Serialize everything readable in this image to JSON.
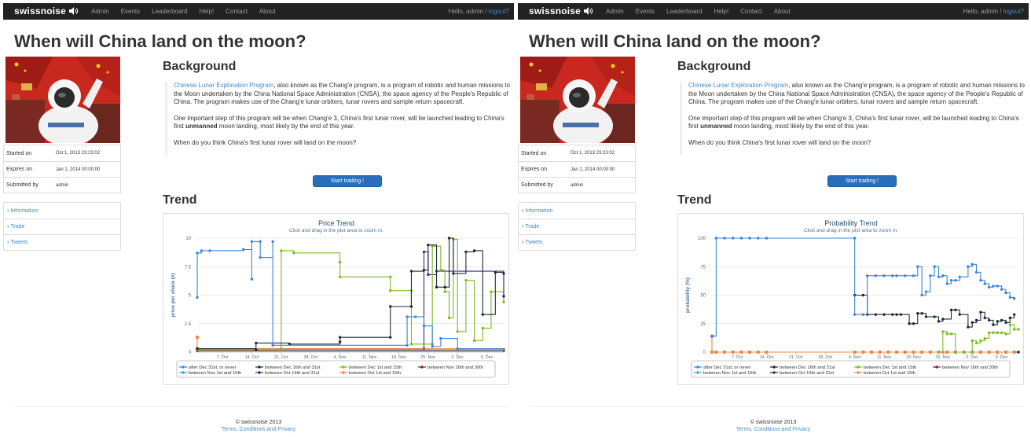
{
  "nav": {
    "brand": "swissnoise",
    "links": [
      "Admin",
      "Events",
      "Leaderboard",
      "Help!",
      "Contact",
      "About"
    ],
    "greeting": "Hello, admin !",
    "logout": "logout?"
  },
  "page": {
    "title": "When will China land on the moon?",
    "info": [
      {
        "label": "Started on",
        "value": "Oct 1, 2013 23:23:02"
      },
      {
        "label": "Expires on",
        "value": "Jan 1, 2014 00:00:00"
      },
      {
        "label": "Submitted by",
        "value": "admin"
      }
    ],
    "sidenav": [
      "Information",
      "Trade",
      "Tweets"
    ],
    "background_heading": "Background",
    "background": {
      "link_text": "Chinese Lunar Exploration Program",
      "p1_rest": ", also known as the Chang'e program, is a program of robotic and human missions to the Moon undertaken by the China National Space Administration (CNSA), the space agency of the People's Republic of China. The program makes use of the Chang'e lunar orbiters, lunar rovers and sample return spacecraft.",
      "p2_before": "One important step of this program will be when Chang'e 3, China's first lunar rover, will be launched leading to China's first ",
      "p2_bold": "unmanned",
      "p2_after": " moon landing, most likely by the end of this year.",
      "p3": "When do you think China's first lunar rover will land on the moon?"
    },
    "cta": "Start trading !",
    "trend_heading": "Trend",
    "footer": {
      "copyright": "© swissnoise 2013",
      "link": "Terms, Conditions and Privacy"
    }
  },
  "colors": {
    "s1": "#3b85d8",
    "s2": "#1c2b3a",
    "s3": "#7cb928",
    "s4": "#8b1e1e",
    "s5": "#2bb5c0",
    "s6": "#3a2a6e",
    "s7": "#e88a4a",
    "navbar": "#222222",
    "link": "#428bca",
    "button": "#2a6ebb"
  },
  "chart_data": [
    {
      "type": "line",
      "title": "Price Trend",
      "subtitle": "Click and drag in the plot area to zoom in.",
      "ylabel": "price per share (¤)",
      "xlabel": "",
      "yticks": [
        0,
        2.5,
        5,
        7.5,
        10
      ],
      "ylim": [
        0,
        10
      ],
      "xticks": [
        "7. Oct",
        "14. Oct",
        "21. Oct",
        "28. Oct",
        "4. Nov",
        "11. Nov",
        "18. Nov",
        "25. Nov",
        "2. Dec",
        "9. Dec"
      ],
      "x_dates": [
        "2013-10-07",
        "2013-10-14",
        "2013-10-21",
        "2013-10-28",
        "2013-11-04",
        "2013-11-11",
        "2013-11-18",
        "2013-11-25",
        "2013-12-02",
        "2013-12-09"
      ],
      "xlim": [
        "2013-10-01",
        "2013-12-13"
      ],
      "grid": true,
      "legend_position": "bottom",
      "series": [
        {
          "name": "after Dec 31st, or never",
          "points": [
            [
              "2013-10-01",
              4.8
            ],
            [
              "2013-10-01",
              8.7
            ],
            [
              "2013-10-02",
              8.9
            ],
            [
              "2013-10-04",
              8.9
            ],
            [
              "2013-10-12",
              9.0
            ],
            [
              "2013-10-14",
              6.4
            ],
            [
              "2013-10-14",
              9.7
            ],
            [
              "2013-10-16",
              9.7
            ],
            [
              "2013-10-16",
              8.3
            ],
            [
              "2013-10-19",
              9.7
            ],
            [
              "2013-10-19",
              0.6
            ],
            [
              "2013-11-20",
              0.6
            ],
            [
              "2013-11-20",
              3.1
            ],
            [
              "2013-11-22",
              3.1
            ],
            [
              "2013-11-24",
              2.3
            ],
            [
              "2013-11-26",
              0.5
            ],
            [
              "2013-11-28",
              1.2
            ],
            [
              "2013-12-02",
              0.3
            ],
            [
              "2013-12-13",
              0.2
            ]
          ]
        },
        {
          "name": "between Dec 16th and 31st",
          "points": [
            [
              "2013-10-01",
              0.3
            ],
            [
              "2013-10-15",
              0.2
            ],
            [
              "2013-10-15",
              0.8
            ],
            [
              "2013-10-23",
              0.7
            ],
            [
              "2013-11-04",
              0.9
            ],
            [
              "2013-11-04",
              1.3
            ],
            [
              "2013-11-16",
              1.3
            ],
            [
              "2013-11-16",
              4.0
            ],
            [
              "2013-11-21",
              4.0
            ],
            [
              "2013-11-21",
              7.1
            ],
            [
              "2013-11-24",
              7.2
            ],
            [
              "2013-11-25",
              9.4
            ],
            [
              "2013-11-27",
              5.7
            ],
            [
              "2013-11-29",
              5.7
            ],
            [
              "2013-11-30",
              10.0
            ],
            [
              "2013-12-01",
              6.9
            ],
            [
              "2013-12-04",
              8.8
            ],
            [
              "2013-12-06",
              8.9
            ],
            [
              "2013-12-08",
              3.3
            ],
            [
              "2013-12-11",
              7.0
            ],
            [
              "2013-12-13",
              4.9
            ]
          ]
        },
        {
          "name": "between Dec 1st and 15th",
          "points": [
            [
              "2013-10-01",
              0.2
            ],
            [
              "2013-10-21",
              0.3
            ],
            [
              "2013-10-21",
              8.9
            ],
            [
              "2013-10-24",
              8.7
            ],
            [
              "2013-11-04",
              7.9
            ],
            [
              "2013-11-04",
              6.6
            ],
            [
              "2013-11-16",
              6.6
            ],
            [
              "2013-11-16",
              5.4
            ],
            [
              "2013-11-21",
              5.4
            ],
            [
              "2013-11-21",
              0.7
            ],
            [
              "2013-11-26",
              0.7
            ],
            [
              "2013-11-26",
              9.3
            ],
            [
              "2013-11-28",
              7.2
            ],
            [
              "2013-11-29",
              5.3
            ],
            [
              "2013-11-30",
              3.0
            ],
            [
              "2013-12-01",
              9.9
            ],
            [
              "2013-12-02",
              1.8
            ],
            [
              "2013-12-04",
              6.3
            ],
            [
              "2013-12-06",
              1.0
            ],
            [
              "2013-12-08",
              2.1
            ],
            [
              "2013-12-10",
              5.3
            ],
            [
              "2013-12-13",
              4.4
            ]
          ]
        },
        {
          "name": "between Nov 16th and 30th",
          "points": [
            [
              "2013-10-01",
              0.1
            ],
            [
              "2013-12-13",
              0.1
            ]
          ]
        },
        {
          "name": "between Nov 1st and 15th",
          "points": [
            [
              "2013-10-01",
              0.2
            ],
            [
              "2013-12-13",
              0.2
            ]
          ]
        },
        {
          "name": "between Oct 16th and 31st",
          "points": [
            [
              "2013-10-01",
              0.3
            ],
            [
              "2013-11-24",
              0.3
            ],
            [
              "2013-11-24",
              8.8
            ],
            [
              "2013-11-25",
              6.8
            ],
            [
              "2013-11-27",
              7.1
            ],
            [
              "2013-12-13",
              6.9
            ]
          ]
        },
        {
          "name": "between Oct 1st and 15th",
          "points": [
            [
              "2013-10-01",
              1.3
            ],
            [
              "2013-10-01",
              0.3
            ],
            [
              "2013-12-13",
              0.2
            ]
          ]
        }
      ]
    },
    {
      "type": "line",
      "title": "Probability Trend",
      "subtitle": "Click and drag in the plot area to zoom in.",
      "ylabel": "probability (%)",
      "xlabel": "",
      "yticks": [
        0,
        25,
        50,
        75,
        100
      ],
      "ylim": [
        0,
        100
      ],
      "xticks": [
        "7. Oct",
        "14. Oct",
        "21. Oct",
        "28. Oct",
        "4. Nov",
        "11. Nov",
        "18. Nov",
        "25. Nov",
        "2. Dec",
        "9. Dec"
      ],
      "x_dates": [
        "2013-10-07",
        "2013-10-14",
        "2013-10-21",
        "2013-10-28",
        "2013-11-04",
        "2013-11-11",
        "2013-11-18",
        "2013-11-25",
        "2013-12-02",
        "2013-12-09"
      ],
      "xlim": [
        "2013-10-01",
        "2013-12-13"
      ],
      "grid": true,
      "legend_position": "bottom",
      "series": [
        {
          "name": "after Dec 31st, or never",
          "points": [
            [
              "2013-10-01",
              14
            ],
            [
              "2013-10-02",
              100
            ],
            [
              "2013-10-04",
              100
            ],
            [
              "2013-10-06",
              100
            ],
            [
              "2013-10-08",
              100
            ],
            [
              "2013-10-10",
              100
            ],
            [
              "2013-10-12",
              100
            ],
            [
              "2013-10-14",
              100
            ],
            [
              "2013-11-04",
              100
            ],
            [
              "2013-11-04",
              33
            ],
            [
              "2013-11-06",
              33
            ],
            [
              "2013-11-07",
              67
            ],
            [
              "2013-11-09",
              67
            ],
            [
              "2013-11-11",
              67
            ],
            [
              "2013-11-13",
              67
            ],
            [
              "2013-11-14",
              67
            ],
            [
              "2013-11-16",
              67
            ],
            [
              "2013-11-18",
              67
            ],
            [
              "2013-11-19",
              75
            ],
            [
              "2013-11-20",
              50
            ],
            [
              "2013-11-21",
              53
            ],
            [
              "2013-11-22",
              67
            ],
            [
              "2013-11-23",
              75
            ],
            [
              "2013-11-24",
              66
            ],
            [
              "2013-11-25",
              67
            ],
            [
              "2013-11-26",
              60
            ],
            [
              "2013-11-27",
              63
            ],
            [
              "2013-11-28",
              63
            ],
            [
              "2013-11-29",
              66
            ],
            [
              "2013-12-01",
              75
            ],
            [
              "2013-12-02",
              77
            ],
            [
              "2013-12-03",
              70
            ],
            [
              "2013-12-04",
              63
            ],
            [
              "2013-12-05",
              60
            ],
            [
              "2013-12-06",
              57
            ],
            [
              "2013-12-07",
              58
            ],
            [
              "2013-12-08",
              58
            ],
            [
              "2013-12-09",
              55
            ],
            [
              "2013-12-10",
              52
            ],
            [
              "2013-12-11",
              48
            ],
            [
              "2013-12-12",
              47
            ]
          ]
        },
        {
          "name": "between Dec 16th and 31st",
          "points": [
            [
              "2013-11-04",
              50
            ],
            [
              "2013-11-06",
              50
            ],
            [
              "2013-11-07",
              33
            ],
            [
              "2013-11-09",
              33
            ],
            [
              "2013-11-11",
              33
            ],
            [
              "2013-11-13",
              33
            ],
            [
              "2013-11-14",
              33
            ],
            [
              "2013-11-15",
              33
            ],
            [
              "2013-11-17",
              25
            ],
            [
              "2013-11-18",
              25
            ],
            [
              "2013-11-19",
              34
            ],
            [
              "2013-11-20",
              34
            ],
            [
              "2013-11-21",
              31
            ],
            [
              "2013-11-23",
              31
            ],
            [
              "2013-11-24",
              27
            ],
            [
              "2013-11-25",
              29
            ],
            [
              "2013-11-27",
              37
            ],
            [
              "2013-11-28",
              37
            ],
            [
              "2013-11-29",
              33
            ],
            [
              "2013-12-01",
              22
            ],
            [
              "2013-12-02",
              26
            ],
            [
              "2013-12-03",
              28
            ],
            [
              "2013-12-04",
              35
            ],
            [
              "2013-12-05",
              30
            ],
            [
              "2013-12-06",
              28
            ],
            [
              "2013-12-07",
              24
            ],
            [
              "2013-12-08",
              27
            ],
            [
              "2013-12-09",
              28
            ],
            [
              "2013-12-10",
              26
            ],
            [
              "2013-12-11",
              30
            ],
            [
              "2013-12-12",
              33
            ]
          ]
        },
        {
          "name": "between Dec 1st and 15th",
          "points": [
            [
              "2013-11-25",
              0
            ],
            [
              "2013-11-25",
              18
            ],
            [
              "2013-11-26",
              16
            ],
            [
              "2013-11-27",
              16
            ],
            [
              "2013-11-28",
              0
            ],
            [
              "2013-12-02",
              10
            ],
            [
              "2013-12-03",
              8
            ],
            [
              "2013-12-04",
              10
            ],
            [
              "2013-12-05",
              12
            ],
            [
              "2013-12-06",
              17
            ],
            [
              "2013-12-07",
              17
            ],
            [
              "2013-12-08",
              17
            ],
            [
              "2013-12-09",
              17
            ],
            [
              "2013-12-10",
              16
            ],
            [
              "2013-12-11",
              24
            ],
            [
              "2013-12-12",
              20
            ],
            [
              "2013-12-13",
              20
            ]
          ]
        },
        {
          "name": "between Nov 16th and 30th",
          "points": [
            [
              "2013-10-01",
              0
            ],
            [
              "2013-12-13",
              0
            ]
          ]
        },
        {
          "name": "between Nov 1st and 15th",
          "points": [
            [
              "2013-10-01",
              0
            ],
            [
              "2013-12-13",
              0
            ]
          ]
        },
        {
          "name": "between Oct 16th and 31st",
          "points": [
            [
              "2013-10-01",
              0
            ],
            [
              "2013-12-13",
              0
            ]
          ]
        },
        {
          "name": "between Oct 1st and 15th",
          "points": [
            [
              "2013-10-01",
              14
            ],
            [
              "2013-10-01",
              0
            ],
            [
              "2013-10-02",
              0
            ],
            [
              "2013-10-04",
              0
            ],
            [
              "2013-10-06",
              0
            ],
            [
              "2013-10-08",
              0
            ],
            [
              "2013-10-10",
              0
            ],
            [
              "2013-10-12",
              0
            ],
            [
              "2013-10-14",
              0
            ],
            [
              "2013-11-04",
              0
            ],
            [
              "2013-11-06",
              0
            ],
            [
              "2013-11-08",
              0
            ],
            [
              "2013-11-10",
              0
            ],
            [
              "2013-11-12",
              0
            ],
            [
              "2013-11-14",
              0
            ],
            [
              "2013-11-16",
              0
            ],
            [
              "2013-11-18",
              0
            ],
            [
              "2013-11-20",
              0
            ],
            [
              "2013-11-22",
              0
            ],
            [
              "2013-11-24",
              0
            ],
            [
              "2013-11-26",
              0
            ],
            [
              "2013-11-28",
              0
            ],
            [
              "2013-11-30",
              0
            ],
            [
              "2013-12-02",
              0
            ],
            [
              "2013-12-04",
              0
            ],
            [
              "2013-12-06",
              0
            ],
            [
              "2013-12-08",
              0
            ],
            [
              "2013-12-10",
              0
            ],
            [
              "2013-12-12",
              0
            ]
          ]
        }
      ]
    }
  ]
}
